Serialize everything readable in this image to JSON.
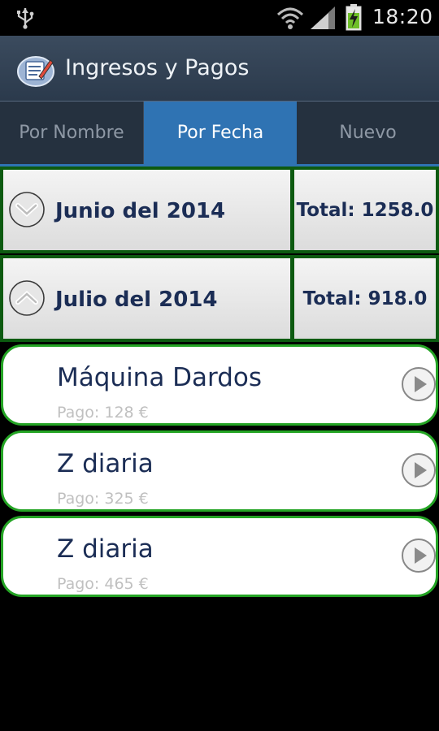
{
  "status_bar": {
    "time": "18:20",
    "icons": [
      "usb-icon",
      "wifi-icon",
      "signal-icon",
      "battery-charging-icon"
    ]
  },
  "action_bar": {
    "title": "Ingresos y Pagos",
    "icon": "notepad-pen-icon"
  },
  "tabs": [
    {
      "label": "Por Nombre",
      "selected": false
    },
    {
      "label": "Por Fecha",
      "selected": true
    },
    {
      "label": "Nuevo",
      "selected": false
    }
  ],
  "groups": [
    {
      "label": "Junio del 2014",
      "total": "Total: 1258.0",
      "expanded": false,
      "icon": "chevron-down-icon"
    },
    {
      "label": "Julio del 2014",
      "total": "Total: 918.0",
      "expanded": true,
      "icon": "chevron-up-icon"
    }
  ],
  "items": [
    {
      "title": "Máquina Dardos",
      "subtitle": "Pago: 128 €",
      "icon": "play-icon"
    },
    {
      "title": "Z diaria",
      "subtitle": "Pago: 325 €",
      "icon": "play-icon"
    },
    {
      "title": "Z diaria",
      "subtitle": "Pago: 465 €",
      "icon": "play-icon"
    }
  ],
  "colors": {
    "accent_tab": "#2f73b3",
    "card_border": "#24a424",
    "group_border": "#0c5a10",
    "text_dark": "#1b2d55"
  }
}
